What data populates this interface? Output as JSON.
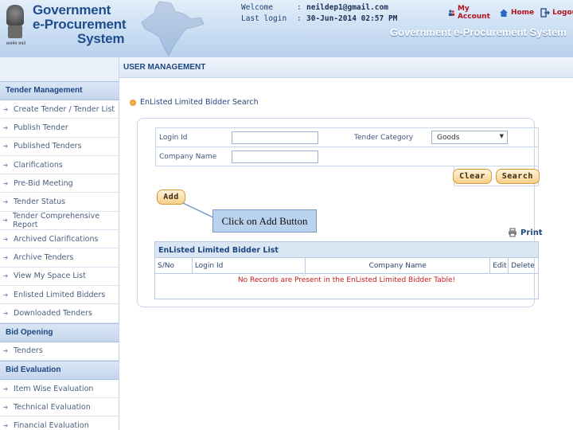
{
  "header": {
    "logo_line1": "Government",
    "logo_line2": "e-Procurement",
    "logo_line3": "System",
    "emblem_motto": "सत्यमेव जयते",
    "welcome_label": "Welcome",
    "welcome_value": "neildep1@gmail.com",
    "lastlogin_label": "Last login",
    "lastlogin_value": "30-Jun-2014 02:57 PM",
    "colon": ":",
    "links": {
      "my_account": "My Account",
      "home": "Home",
      "logout": "Logout"
    },
    "system_title": "Government e-Procurement System"
  },
  "sidebar": {
    "sections": [
      {
        "title": "Tender Management",
        "items": [
          "Create Tender / Tender List",
          "Publish Tender",
          "Published Tenders",
          "Clarifications",
          "Pre-Bid Meeting",
          "Tender Status",
          "Tender Comprehensive Report",
          "Archived Clarifications",
          "Archive Tenders",
          "View My Space List",
          "Enlisted Limited Bidders",
          "Downloaded Tenders"
        ]
      },
      {
        "title": "Bid Opening",
        "items": [
          "Tenders"
        ]
      },
      {
        "title": "Bid Evaluation",
        "items": [
          "Item Wise Evaluation",
          "Technical Evaluation",
          "Financial Evaluation"
        ]
      }
    ]
  },
  "main": {
    "heading": "USER MANAGEMENT",
    "breadcrumb": "EnListed Limited Bidder Search",
    "form": {
      "login_id_label": "Login Id",
      "login_id_value": "",
      "tender_category_label": "Tender Category",
      "tender_category_value": "Goods",
      "company_name_label": "Company Name",
      "company_name_value": ""
    },
    "buttons": {
      "clear": "Clear",
      "search": "Search",
      "add": "Add"
    },
    "callout": "Click on Add Button",
    "print": "Print",
    "list": {
      "title": "EnListed Limited Bidder List",
      "columns": [
        "S/No",
        "Login Id",
        "Company Name",
        "Edit",
        "Delete"
      ],
      "empty_message": "No Records are Present in the EnListed Limited Bidder Table!"
    }
  },
  "colors": {
    "brand_blue": "#1f4e8c",
    "button_orange": "#f7cf8a",
    "error_red": "#cc1b1b"
  }
}
